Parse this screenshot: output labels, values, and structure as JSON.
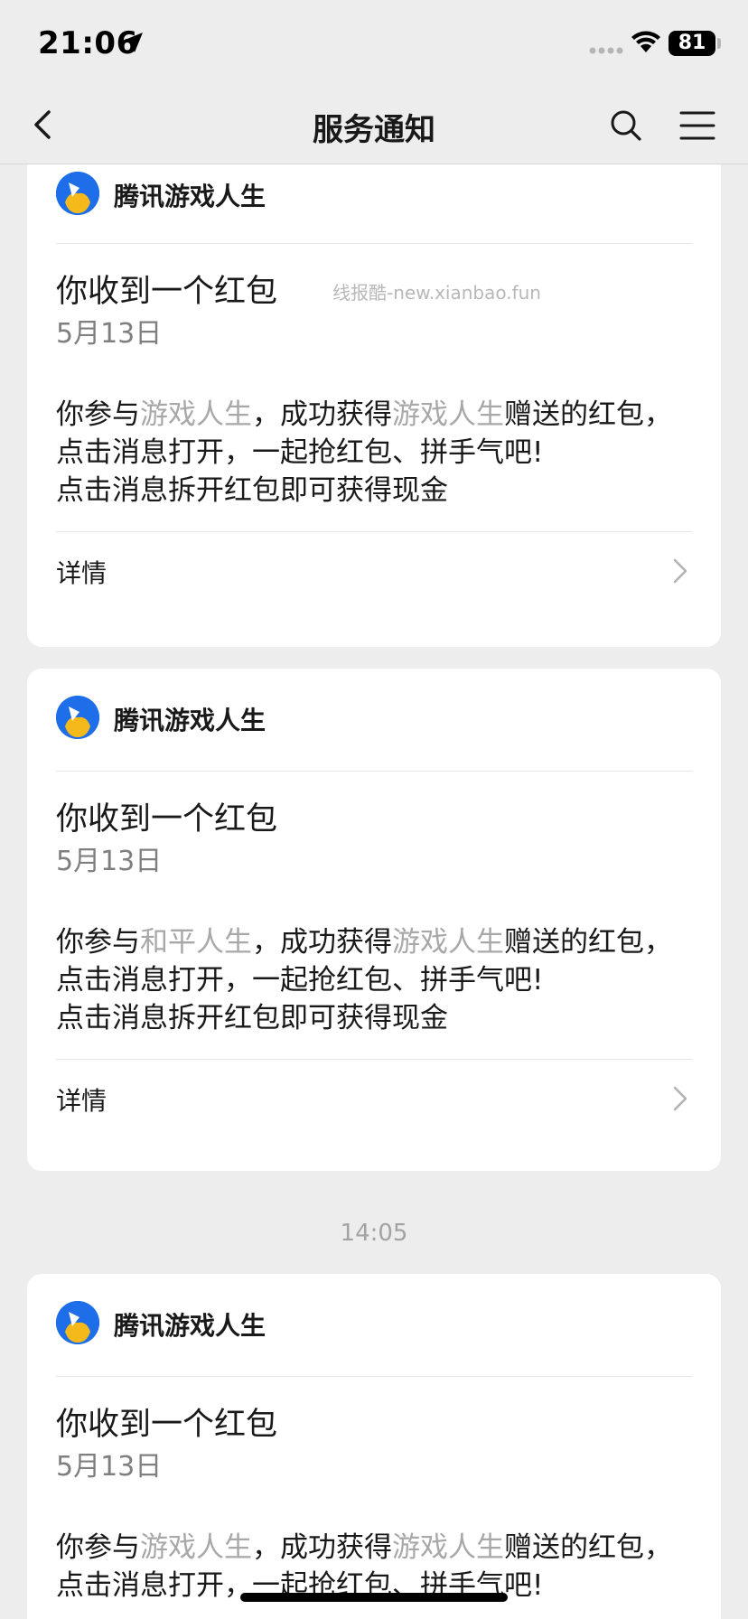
{
  "status_bar": {
    "time": "21:06",
    "battery": "81",
    "icons": [
      "location-arrow-icon",
      "signal-icon",
      "wifi-icon",
      "battery-icon"
    ]
  },
  "nav": {
    "title": "服务通知",
    "icons": [
      "back-icon",
      "search-icon",
      "menu-icon"
    ]
  },
  "watermark": "线报酷-new.xianbao.fun",
  "time_divider": "14:05",
  "cards": [
    {
      "sender": "腾讯游戏人生",
      "title": "你收到一个红包",
      "date": "5月13日",
      "body": {
        "p1": "你参与",
        "hl1": "游戏人生",
        "p2": "，成功获得",
        "hl2": "游戏人生",
        "p3": "赠送的红包，点击消息打开，一起抢红包、拼手气吧!",
        "line3": "点击消息拆开红包即可获得现金"
      },
      "detail": "详情"
    },
    {
      "sender": "腾讯游戏人生",
      "title": "你收到一个红包",
      "date": "5月13日",
      "body": {
        "p1": "你参与",
        "hl1": "和平人生",
        "p2": "，成功获得",
        "hl2": "游戏人生",
        "p3": "赠送的红包，点击消息打开，一起抢红包、拼手气吧!",
        "line3": "点击消息拆开红包即可获得现金"
      },
      "detail": "详情"
    },
    {
      "sender": "腾讯游戏人生",
      "title": "你收到一个红包",
      "date": "5月13日",
      "body": {
        "p1": "你参与",
        "hl1": "游戏人生",
        "p2": "，成功获得",
        "hl2": "游戏人生",
        "p3": "赠送的红包，点击消息打开，一起抢红包、拼手气吧!",
        "line3": ""
      },
      "detail": ""
    }
  ],
  "colors": {
    "background": "#ededed",
    "card": "#ffffff",
    "highlight_text": "#a8a8a8",
    "avatar_blue": "#1d6ee8",
    "avatar_yellow": "#f6b91c"
  }
}
